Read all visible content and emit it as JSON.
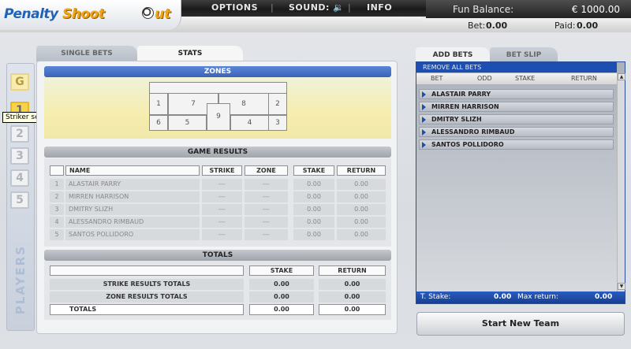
{
  "logo": {
    "part1": "Penalty",
    "part2": "Shoot",
    "part3": "ut"
  },
  "menu": {
    "options": "OPTIONS",
    "sound": "SOUND: 🔉",
    "info": "INFO",
    "sep": "|"
  },
  "balance": {
    "label": "Fun Balance:",
    "value": "€ 1000.00"
  },
  "bet": {
    "bet_label": "Bet:",
    "bet_value": "0.00",
    "paid_label": "Paid:",
    "paid_value": "0.00"
  },
  "players": {
    "g_label": "G",
    "numbers": [
      "1",
      "2",
      "3",
      "4",
      "5"
    ],
    "label": "PLAYERS",
    "tooltip": "Striker select menu"
  },
  "tabs": {
    "single_bets": "SINGLE BETS",
    "stats": "STATS"
  },
  "zones": {
    "title": "ZONES",
    "numbers": [
      "1",
      "7",
      "8",
      "2",
      "6",
      "5",
      "9",
      "4",
      "3"
    ]
  },
  "game_results": {
    "title": "GAME RESULTS",
    "columns": {
      "name": "NAME",
      "strike": "STRIKE",
      "zone": "ZONE",
      "stake": "STAKE",
      "return": "RETURN"
    },
    "rows": [
      {
        "num": "1",
        "name": "ALASTAIR PARRY",
        "strike": "---",
        "zone": "---",
        "stake": "0.00",
        "return": "0.00"
      },
      {
        "num": "2",
        "name": "MIRREN HARRISON",
        "strike": "---",
        "zone": "---",
        "stake": "0.00",
        "return": "0.00"
      },
      {
        "num": "3",
        "name": "DMITRY SLIZH",
        "strike": "---",
        "zone": "---",
        "stake": "0.00",
        "return": "0.00"
      },
      {
        "num": "4",
        "name": "ALESSANDRO RIMBAUD",
        "strike": "---",
        "zone": "---",
        "stake": "0.00",
        "return": "0.00"
      },
      {
        "num": "5",
        "name": "SANTOS POLLIDORO",
        "strike": "---",
        "zone": "---",
        "stake": "0.00",
        "return": "0.00"
      }
    ]
  },
  "totals": {
    "title": "TOTALS",
    "columns": {
      "stake": "STAKE",
      "return": "RETURN"
    },
    "rows": [
      {
        "label": "STRIKE RESULTS TOTALS",
        "stake": "0.00",
        "return": "0.00"
      },
      {
        "label": "ZONE RESULTS TOTALS",
        "stake": "0.00",
        "return": "0.00"
      },
      {
        "label": "TOTALS",
        "stake": "0.00",
        "return": "0.00"
      }
    ]
  },
  "right_tabs": {
    "add_bets": "ADD BETS",
    "bet_slip": "BET SLIP"
  },
  "bets_panel": {
    "remove_all": "REMOVE ALL BETS",
    "columns": {
      "bet": "BET",
      "odd": "ODD",
      "stake": "STAKE",
      "return": "RETURN"
    },
    "players": [
      "ALASTAIR PARRY",
      "MIRREN HARRISON",
      "DMITRY SLIZH",
      "ALESSANDRO RIMBAUD",
      "SANTOS POLLIDORO"
    ],
    "t_stake_label": "T. Stake:",
    "t_stake_value": "0.00",
    "max_return_label": "Max return:",
    "max_return_value": "0.00",
    "scroll_up": "▲",
    "scroll_down": "▼"
  },
  "start_button": "Start New Team",
  "colors": {
    "accent_blue": "#1d4fb0",
    "gold": "#f1a415",
    "zone_yellow": "#f6edae"
  }
}
